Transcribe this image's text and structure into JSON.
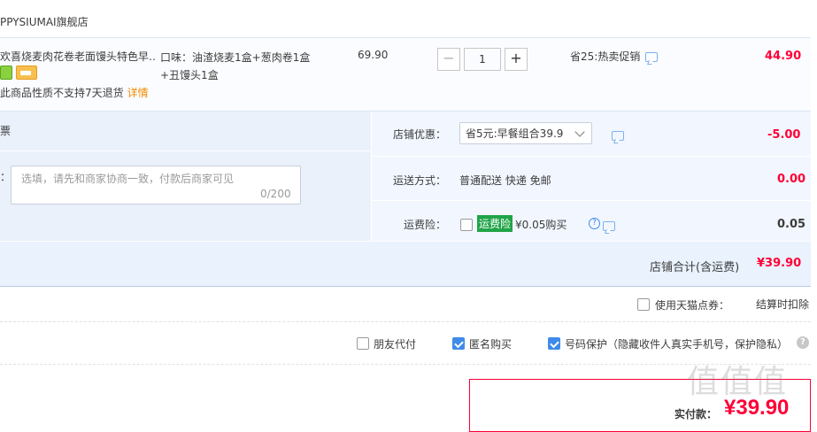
{
  "store": {
    "name": "PPYSIUMAI旗舰店"
  },
  "item": {
    "title": "欢喜烧麦肉花卷老面馒头特色早…",
    "return_note": "此商品性质不支持7天退货",
    "detail_link": "详情",
    "flavor_line1": "口味：油渣烧麦1盒+葱肉卷1盒",
    "flavor_line2": "+丑馒头1盒",
    "unit_price": "69.90",
    "qty_minus": "−",
    "quantity": "1",
    "qty_plus": "+",
    "promo": "省25:热卖促销",
    "subtotal": "44.90"
  },
  "invoice": {
    "label": "票"
  },
  "message": {
    "label": "：",
    "placeholder": "选填，请先和商家协商一致，付款后商家可见",
    "counter": "0/200"
  },
  "shop_discount": {
    "label": "店铺优惠：",
    "selected": "省5元:早餐组合39.9",
    "amount": "-5.00"
  },
  "shipping": {
    "label": "运送方式：",
    "method": "普通配送 快递 免邮",
    "cost": "0.00"
  },
  "insurance": {
    "label": "运费险：",
    "tag": "运费险",
    "price": "¥0.05购买",
    "amount": "0.05",
    "checked": false
  },
  "shop_total": {
    "label": "店铺合计(含运费)",
    "value": "¥39.90"
  },
  "coupon": {
    "label": "使用天猫点券：",
    "deduct_text": "结算时扣除",
    "checked": false
  },
  "options": [
    {
      "label": "朋友代付",
      "checked": false
    },
    {
      "label": "匿名购买",
      "checked": true
    },
    {
      "label": "号码保护（隐藏收件人真实手机号，保护隐私）",
      "checked": true
    }
  ],
  "help_glyph": "?",
  "payment": {
    "label": "实付款：",
    "amount": "¥39.90"
  },
  "watermark": "值值值",
  "colors": {
    "price_red": "#ff0036",
    "accent_blue": "#3e8bea",
    "panel_blue": "#eaf1fb",
    "promo_green": "#20a447"
  }
}
